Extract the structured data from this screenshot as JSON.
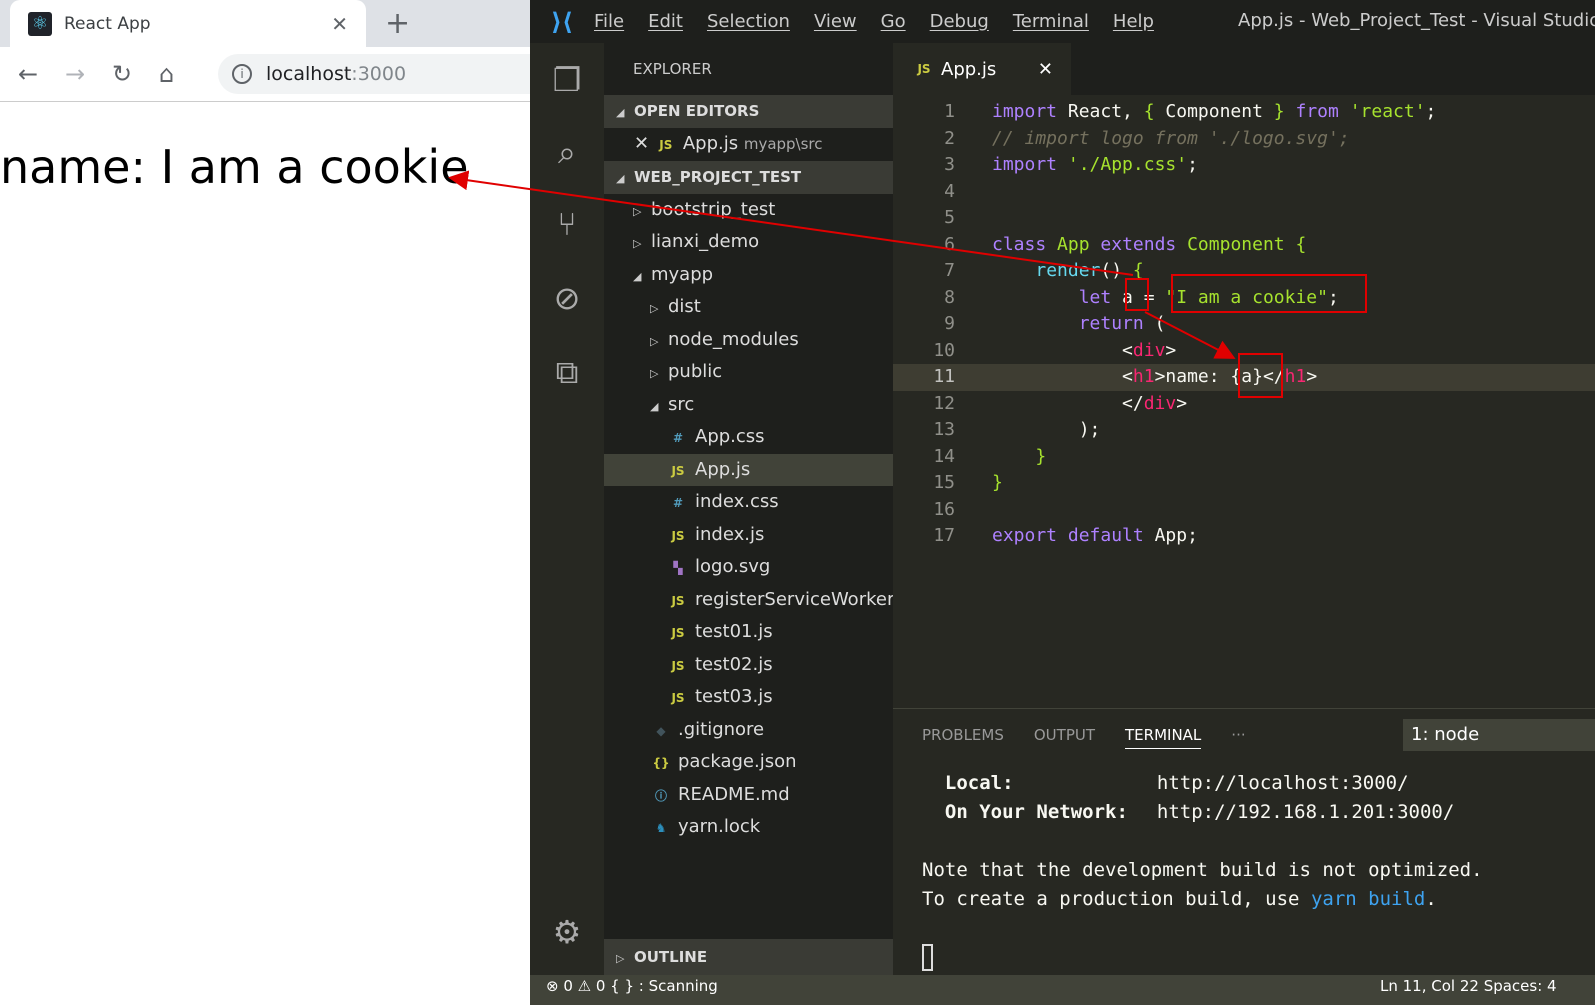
{
  "browser": {
    "tab_title": "React App",
    "favicon": "react-atom-icon",
    "url_host": "localhost",
    "url_port": ":3000",
    "page_heading": "name: I am a cookie"
  },
  "vscode": {
    "menu": [
      "File",
      "Edit",
      "Selection",
      "View",
      "Go",
      "Debug",
      "Terminal",
      "Help"
    ],
    "window_title": "App.js - Web_Project_Test - Visual Studio Code",
    "activity": [
      "files-icon",
      "search-icon",
      "source-control-icon",
      "debug-icon",
      "extensions-icon",
      "gear-icon"
    ],
    "explorer": {
      "title": "EXPLORER",
      "open_editors": "OPEN EDITORS",
      "open_file": "App.js",
      "open_file_path": "myapp\\src",
      "project": "WEB_PROJECT_TEST",
      "outline": "OUTLINE",
      "tree": [
        {
          "label": "bootstrip_test",
          "kind": "folder",
          "depth": 1,
          "open": false
        },
        {
          "label": "lianxi_demo",
          "kind": "folder",
          "depth": 1,
          "open": false
        },
        {
          "label": "myapp",
          "kind": "folder",
          "depth": 1,
          "open": true
        },
        {
          "label": "dist",
          "kind": "folder",
          "depth": 2,
          "open": false
        },
        {
          "label": "node_modules",
          "kind": "folder",
          "depth": 2,
          "open": false
        },
        {
          "label": "public",
          "kind": "folder",
          "depth": 2,
          "open": false
        },
        {
          "label": "src",
          "kind": "folder",
          "depth": 2,
          "open": true
        },
        {
          "label": "App.css",
          "kind": "css",
          "depth": 3
        },
        {
          "label": "App.js",
          "kind": "js",
          "depth": 3,
          "selected": true
        },
        {
          "label": "index.css",
          "kind": "css",
          "depth": 3
        },
        {
          "label": "index.js",
          "kind": "js",
          "depth": 3
        },
        {
          "label": "logo.svg",
          "kind": "svg",
          "depth": 3
        },
        {
          "label": "registerServiceWorker.js",
          "kind": "js",
          "depth": 3
        },
        {
          "label": "test01.js",
          "kind": "js",
          "depth": 3
        },
        {
          "label": "test02.js",
          "kind": "js",
          "depth": 3
        },
        {
          "label": "test03.js",
          "kind": "js",
          "depth": 3
        },
        {
          "label": ".gitignore",
          "kind": "git",
          "depth": 2
        },
        {
          "label": "package.json",
          "kind": "json",
          "depth": 2
        },
        {
          "label": "README.md",
          "kind": "md",
          "depth": 2
        },
        {
          "label": "yarn.lock",
          "kind": "yarn",
          "depth": 2
        }
      ]
    },
    "editor_tab": "App.js",
    "current_line": 11,
    "code": [
      [
        [
          "kw",
          "import"
        ],
        [
          "pl",
          " React, "
        ],
        [
          "st",
          "{"
        ],
        [
          "pl",
          " Component "
        ],
        [
          "st",
          "}"
        ],
        [
          "pl",
          " "
        ],
        [
          "kw",
          "from"
        ],
        [
          "pl",
          " "
        ],
        [
          "st",
          "'react'"
        ],
        [
          "pl",
          ";"
        ]
      ],
      [
        [
          "cm",
          "// import logo from './logo.svg';"
        ]
      ],
      [
        [
          "kw",
          "import"
        ],
        [
          "pl",
          " "
        ],
        [
          "st",
          "'./App.css'"
        ],
        [
          "pl",
          ";"
        ]
      ],
      [],
      [],
      [
        [
          "kw",
          "class"
        ],
        [
          "pl",
          " "
        ],
        [
          "cl",
          "App"
        ],
        [
          "pl",
          " "
        ],
        [
          "kw",
          "extends"
        ],
        [
          "pl",
          " "
        ],
        [
          "cl",
          "Component"
        ],
        [
          "pl",
          " "
        ],
        [
          "st",
          "{"
        ]
      ],
      [
        [
          "pl",
          "    "
        ],
        [
          "fn",
          "render"
        ],
        [
          "pl",
          "() "
        ],
        [
          "st",
          "{"
        ]
      ],
      [
        [
          "pl",
          "        "
        ],
        [
          "kw",
          "let"
        ],
        [
          "pl",
          " a = "
        ],
        [
          "st",
          "\"I am a cookie\""
        ],
        [
          "pl",
          ";"
        ]
      ],
      [
        [
          "pl",
          "        "
        ],
        [
          "kw",
          "return"
        ],
        [
          "pl",
          " ("
        ]
      ],
      [
        [
          "pl",
          "            <"
        ],
        [
          "tg",
          "div"
        ],
        [
          "pl",
          ">"
        ]
      ],
      [
        [
          "pl",
          "            <"
        ],
        [
          "tg",
          "h1"
        ],
        [
          "pl",
          ">name: {a}</"
        ],
        [
          "tg",
          "h1"
        ],
        [
          "pl",
          ">"
        ]
      ],
      [
        [
          "pl",
          "            </"
        ],
        [
          "tg",
          "div"
        ],
        [
          "pl",
          ">"
        ]
      ],
      [
        [
          "pl",
          "        );"
        ]
      ],
      [
        [
          "pl",
          "    "
        ],
        [
          "st",
          "}"
        ]
      ],
      [
        [
          "st",
          "}"
        ]
      ],
      [],
      [
        [
          "kw",
          "export"
        ],
        [
          "pl",
          " "
        ],
        [
          "kw",
          "default"
        ],
        [
          "pl",
          " App;"
        ]
      ]
    ],
    "panel": {
      "tabs": [
        "PROBLEMS",
        "OUTPUT",
        "TERMINAL",
        "···"
      ],
      "active": "TERMINAL",
      "terminal_select": "1: node",
      "lines": {
        "local_label": "Local:",
        "local_url": "http://localhost:3000/",
        "net_label": "On Your Network:",
        "net_url": "http://192.168.1.201:3000/",
        "note1": "Note that the development build is not optimized.",
        "note2_pre": "To create a production build, use ",
        "note2_cmd": "yarn build",
        "note2_post": "."
      }
    },
    "status": {
      "left": "⊗ 0  ⚠ 0   { } : Scanning",
      "right": "Ln 11, Col 22   Spaces: 4"
    }
  },
  "annotation_color": "#e00000"
}
